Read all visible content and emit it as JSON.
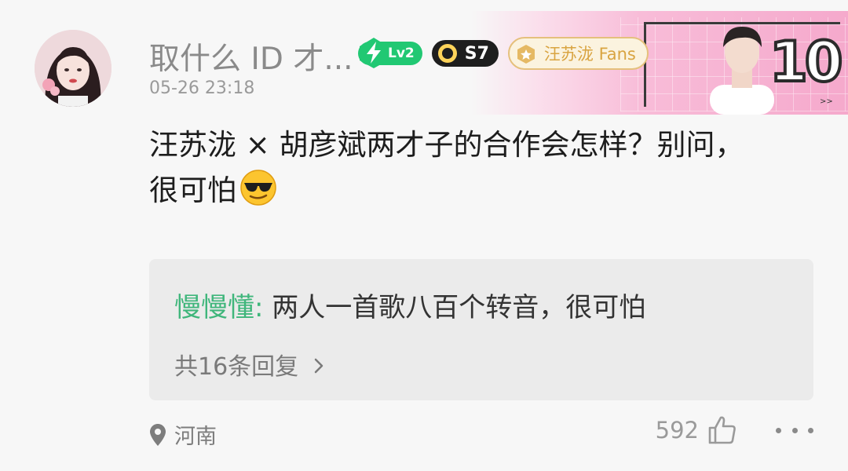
{
  "comment": {
    "username": "取什么 ID 才...",
    "level_badge": "Lv2",
    "season_badge": "S7",
    "fan_badge": "汪苏泷 Fans",
    "timestamp": "05-26 23:18",
    "text_line1": "汪苏泷 × 胡彦斌两才子的合作会怎样？别问，",
    "text_line2": "很可怕",
    "emoji": "sunglasses-emoji",
    "header_banner_number": "10"
  },
  "reply_preview": {
    "author": "慢慢懂:",
    "text": "两人一首歌八百个转音，很可怕",
    "more_replies": "共16条回复"
  },
  "footer": {
    "location": "河南",
    "likes": "592"
  },
  "icons": {
    "location": "location-pin-icon",
    "like": "thumbs-up-icon",
    "more": "more-dots-icon",
    "chevron": "chevron-right-icon"
  },
  "colors": {
    "accent_green": "#3fb67b",
    "level_badge": "#21c873",
    "fan_badge_gold": "#d9a441",
    "banner_pink": "#f5a9cc"
  }
}
